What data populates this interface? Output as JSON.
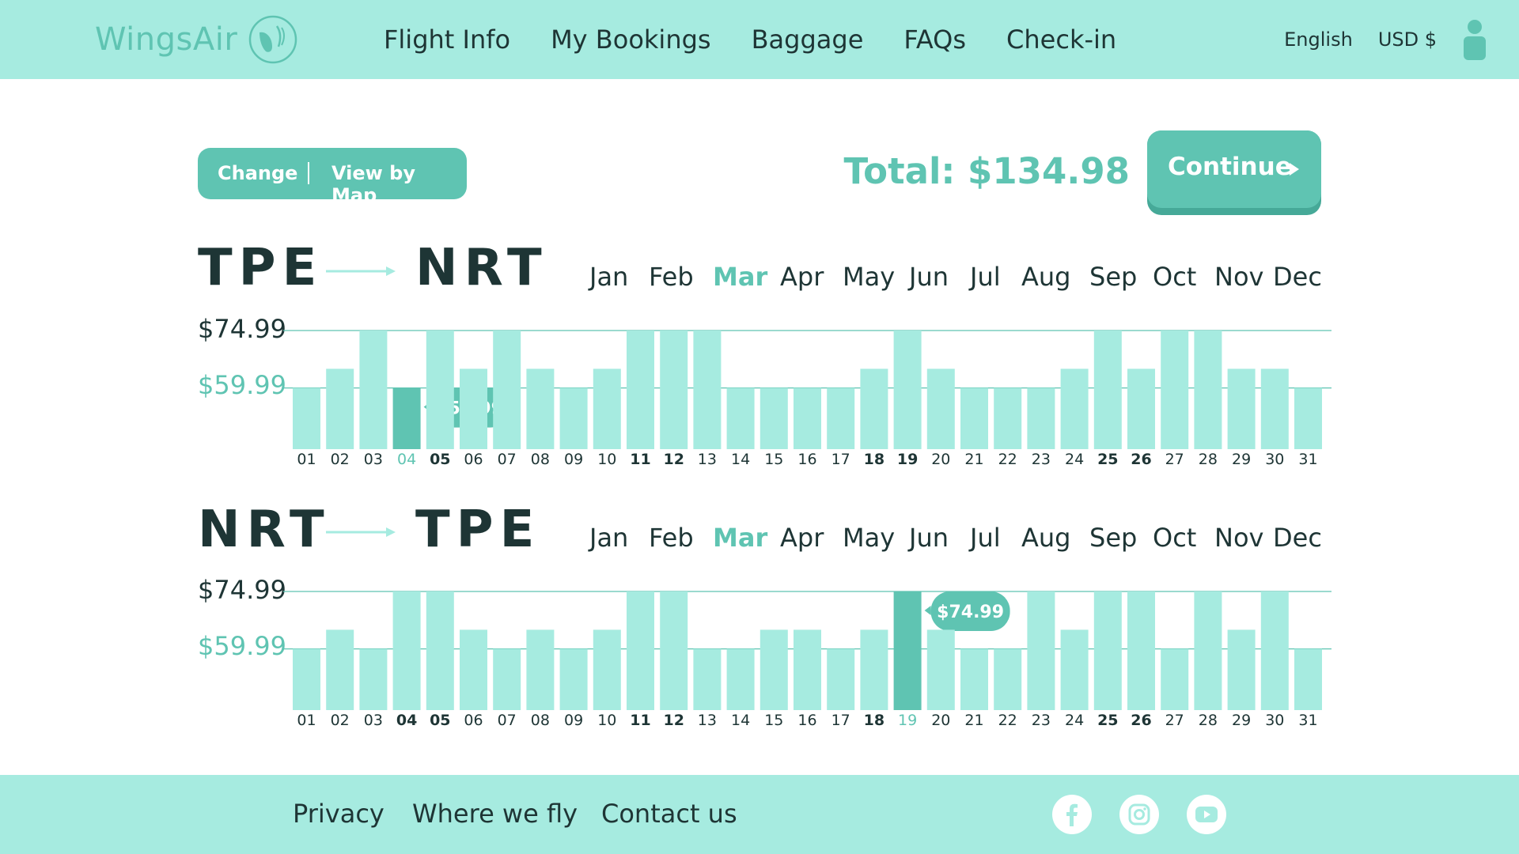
{
  "header": {
    "logo_text": "WingsAir",
    "nav": [
      "Flight Info",
      "My Bookings",
      "Baggage",
      "FAQs",
      "Check-in"
    ],
    "language": "English",
    "currency": "USD $"
  },
  "actions": {
    "change_label": "Change",
    "map_label": "View by Map",
    "total": "Total: $134.98",
    "continue_label": "Continue"
  },
  "colors": {
    "accent": "#5fc4b2",
    "bar": "#a6ebe0",
    "text": "#1e3535",
    "header_bg": "#a6ebe0"
  },
  "months": [
    "Jan",
    "Feb",
    "Mar",
    "Apr",
    "May",
    "Jun",
    "Jul",
    "Aug",
    "Sep",
    "Oct",
    "Nov",
    "Dec"
  ],
  "price_levels": [
    "$74.99",
    "$59.99"
  ],
  "chart_data": [
    {
      "type": "bar",
      "from": "TPE",
      "to": "NRT",
      "selected_month": "Mar",
      "categories": [
        "01",
        "02",
        "03",
        "04",
        "05",
        "06",
        "07",
        "08",
        "09",
        "10",
        "11",
        "12",
        "13",
        "14",
        "15",
        "16",
        "17",
        "18",
        "19",
        "20",
        "21",
        "22",
        "23",
        "24",
        "25",
        "26",
        "27",
        "28",
        "29",
        "30",
        "31"
      ],
      "bold_days": [
        "05",
        "11",
        "12",
        "18",
        "19",
        "25",
        "26"
      ],
      "values": [
        59.99,
        64.99,
        74.99,
        59.99,
        74.99,
        64.99,
        74.99,
        64.99,
        59.99,
        64.99,
        74.99,
        74.99,
        74.99,
        59.99,
        59.99,
        59.99,
        59.99,
        64.99,
        74.99,
        64.99,
        59.99,
        59.99,
        59.99,
        64.99,
        74.99,
        64.99,
        74.99,
        74.99,
        64.99,
        64.99,
        59.99
      ],
      "selected_day": "04",
      "tooltip": "$59.99",
      "ylim": [
        44,
        74.99
      ]
    },
    {
      "type": "bar",
      "from": "NRT",
      "to": "TPE",
      "selected_month": "Mar",
      "categories": [
        "01",
        "02",
        "03",
        "04",
        "05",
        "06",
        "07",
        "08",
        "09",
        "10",
        "11",
        "12",
        "13",
        "14",
        "15",
        "16",
        "17",
        "18",
        "19",
        "20",
        "21",
        "22",
        "23",
        "24",
        "25",
        "26",
        "27",
        "28",
        "29",
        "30",
        "31"
      ],
      "bold_days": [
        "04",
        "05",
        "11",
        "12",
        "18",
        "25",
        "26"
      ],
      "values": [
        59.99,
        64.99,
        59.99,
        74.99,
        74.99,
        64.99,
        59.99,
        64.99,
        59.99,
        64.99,
        74.99,
        74.99,
        59.99,
        59.99,
        64.99,
        64.99,
        59.99,
        64.99,
        74.99,
        64.99,
        59.99,
        59.99,
        74.99,
        64.99,
        74.99,
        74.99,
        59.99,
        74.99,
        64.99,
        74.99,
        59.99
      ],
      "selected_day": "19",
      "tooltip": "$74.99",
      "ylim": [
        44,
        74.99
      ]
    }
  ],
  "footer": {
    "links": [
      "Privacy",
      "Where we fly",
      "Contact us"
    ]
  }
}
